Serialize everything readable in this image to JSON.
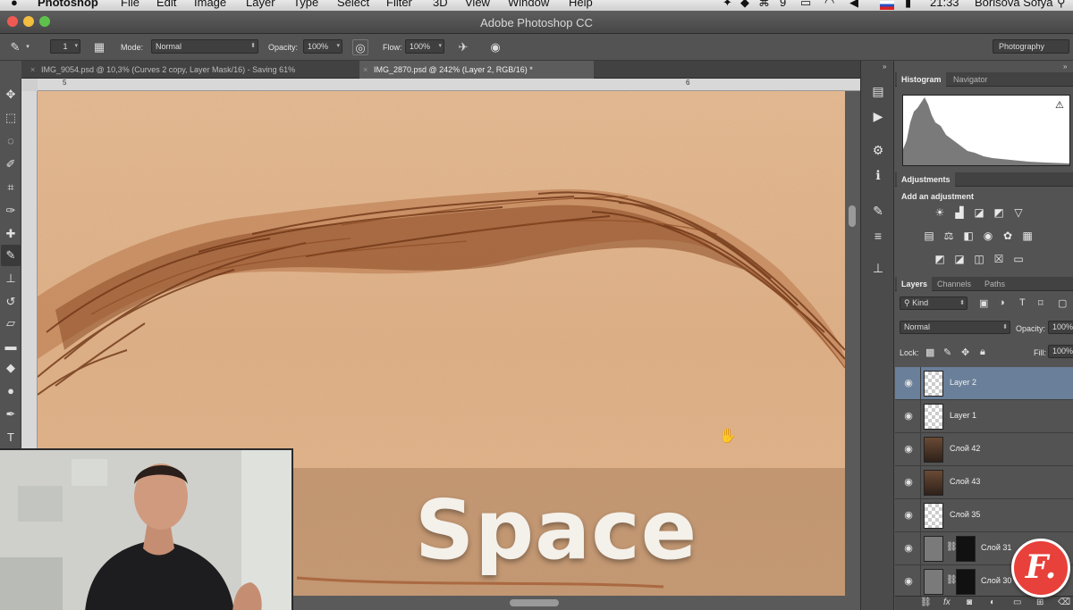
{
  "menubar": {
    "apple_icon": "apple-icon",
    "items": [
      "Photoshop",
      "File",
      "Edit",
      "Image",
      "Layer",
      "Type",
      "Select",
      "Filter",
      "3D",
      "View",
      "Window",
      "Help"
    ],
    "status": {
      "count": "9",
      "time": "21:33",
      "user": "Borisova Sofya"
    }
  },
  "titlebar": {
    "title": "Adobe Photoshop CC"
  },
  "options": {
    "brush_size": "1",
    "mode_label": "Mode:",
    "mode_value": "Normal",
    "opacity_label": "Opacity:",
    "opacity_value": "100%",
    "flow_label": "Flow:",
    "flow_value": "100%",
    "workspace": "Photography"
  },
  "tabs": [
    {
      "label": "IMG_9054.psd @ 10,3% (Curves 2 copy, Layer Mask/16) - Saving 61%",
      "active": false
    },
    {
      "label": "IMG_2870.psd @ 242% (Layer 2, RGB/16) *",
      "active": true
    }
  ],
  "rulers": {
    "top_5": "5",
    "top_6": "6"
  },
  "overlay": {
    "caption": "Space"
  },
  "panels": {
    "top_tabs": [
      "Histogram",
      "Navigator"
    ],
    "adjust_tab": "Adjustments",
    "add_adjustment": "Add an adjustment",
    "layer_tabs": [
      "Layers",
      "Channels",
      "Paths"
    ],
    "kind_label": "Kind",
    "blend_mode": "Normal",
    "opacity_label": "Opacity:",
    "opacity_value": "100%",
    "lock_label": "Lock:",
    "fill_label": "Fill:",
    "fill_value": "100%"
  },
  "layers": [
    {
      "name": "Layer 2",
      "thumb": "checker",
      "selected": true,
      "mask": false
    },
    {
      "name": "Layer 1",
      "thumb": "checker",
      "selected": false,
      "mask": false
    },
    {
      "name": "Слой 42",
      "thumb": "photo",
      "selected": false,
      "mask": false
    },
    {
      "name": "Слой 43",
      "thumb": "photo",
      "selected": false,
      "mask": false
    },
    {
      "name": "Слой 35",
      "thumb": "checker",
      "selected": false,
      "mask": false
    },
    {
      "name": "Слой 31",
      "thumb": "gray",
      "selected": false,
      "mask": true
    },
    {
      "name": "Слой 30",
      "thumb": "gray",
      "selected": false,
      "mask": true
    }
  ],
  "badge": {
    "text": "F."
  },
  "colors": {
    "selected_layer": "#6a7f99",
    "badge": "#e8403a",
    "skin": "#e3b48a",
    "brow": "#7a3f1e"
  }
}
